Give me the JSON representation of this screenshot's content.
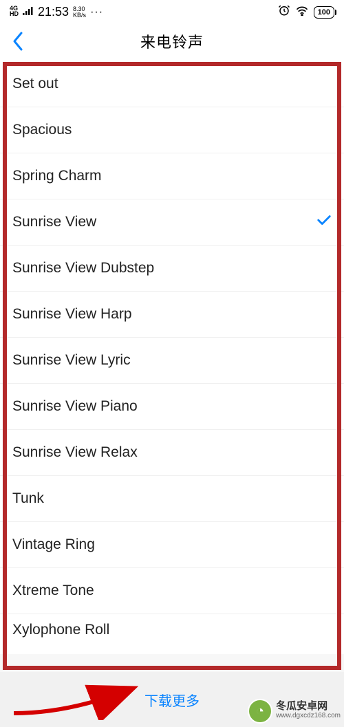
{
  "statusBar": {
    "networkType": "4G HD",
    "time": "21:53",
    "dataRate": "8.30",
    "dataUnit": "KB/s",
    "dots": "···",
    "battery": "100"
  },
  "header": {
    "title": "来电铃声"
  },
  "ringtones": {
    "items": [
      {
        "label": "Set out",
        "selected": false
      },
      {
        "label": "Spacious",
        "selected": false
      },
      {
        "label": "Spring Charm",
        "selected": false
      },
      {
        "label": "Sunrise View",
        "selected": true
      },
      {
        "label": "Sunrise View Dubstep",
        "selected": false
      },
      {
        "label": "Sunrise View Harp",
        "selected": false
      },
      {
        "label": "Sunrise View Lyric",
        "selected": false
      },
      {
        "label": "Sunrise View Piano",
        "selected": false
      },
      {
        "label": "Sunrise View Relax",
        "selected": false
      },
      {
        "label": "Tunk",
        "selected": false
      },
      {
        "label": "Vintage Ring",
        "selected": false
      },
      {
        "label": "Xtreme Tone",
        "selected": false
      },
      {
        "label": "Xylophone Roll",
        "selected": false
      }
    ]
  },
  "footer": {
    "downloadMore": "下载更多"
  },
  "watermark": {
    "name": "冬瓜安卓网",
    "url": "www.dgxcdz168.com"
  }
}
